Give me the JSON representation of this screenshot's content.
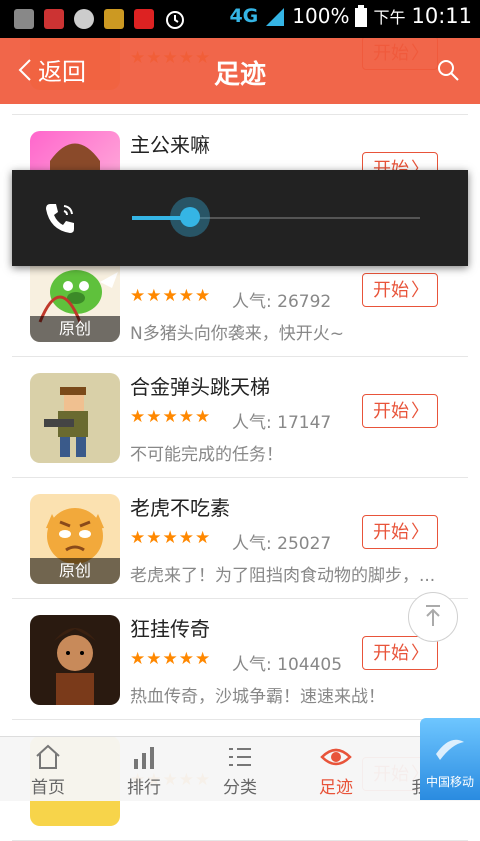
{
  "status_bar": {
    "network": "4G",
    "battery": "100%",
    "ampm": "下午",
    "time": "10:11"
  },
  "header": {
    "back_label": "返回",
    "title": "足迹"
  },
  "items": [
    {
      "name": "",
      "stars": "★★★★★",
      "popularity": "",
      "desc": "",
      "start": "开始",
      "badge": ""
    },
    {
      "name": "主公来嘛",
      "stars": "★★★★★",
      "popularity": "",
      "desc": "",
      "start": "开始",
      "badge": ""
    },
    {
      "name": "",
      "stars": "★★★★★",
      "popularity": "人气: 26792",
      "desc": "N多猪头向你袭来，快开火~",
      "start": "开始",
      "badge": "原创"
    },
    {
      "name": "合金弹头跳天梯",
      "stars": "★★★★★",
      "popularity": "人气: 17147",
      "desc": "不可能完成的任务！",
      "start": "开始",
      "badge": ""
    },
    {
      "name": "老虎不吃素",
      "stars": "★★★★★",
      "popularity": "人气: 25027",
      "desc": "老虎来了！为了阻挡肉食动物的脚步，...",
      "start": "开始",
      "badge": "原创"
    },
    {
      "name": "狂挂传奇",
      "stars": "★★★★★",
      "popularity": "人气: 104405",
      "desc": "热血传奇，沙城争霸！速速来战！",
      "start": "开始",
      "badge": ""
    },
    {
      "name": "",
      "stars": "★★★★★",
      "popularity": "",
      "desc": "",
      "start": "开始",
      "badge": ""
    }
  ],
  "volume": {
    "level": 0.2
  },
  "nav": [
    {
      "label": "首页",
      "icon": "home-icon"
    },
    {
      "label": "排行",
      "icon": "bar-chart-icon"
    },
    {
      "label": "分类",
      "icon": "list-icon"
    },
    {
      "label": "足迹",
      "icon": "eye-icon"
    },
    {
      "label": "我",
      "icon": "user-icon"
    }
  ],
  "carrier": "中国移动",
  "colors": {
    "accent": "#e8543a",
    "header": "#f05a3c",
    "volume": "#35b5e5"
  }
}
